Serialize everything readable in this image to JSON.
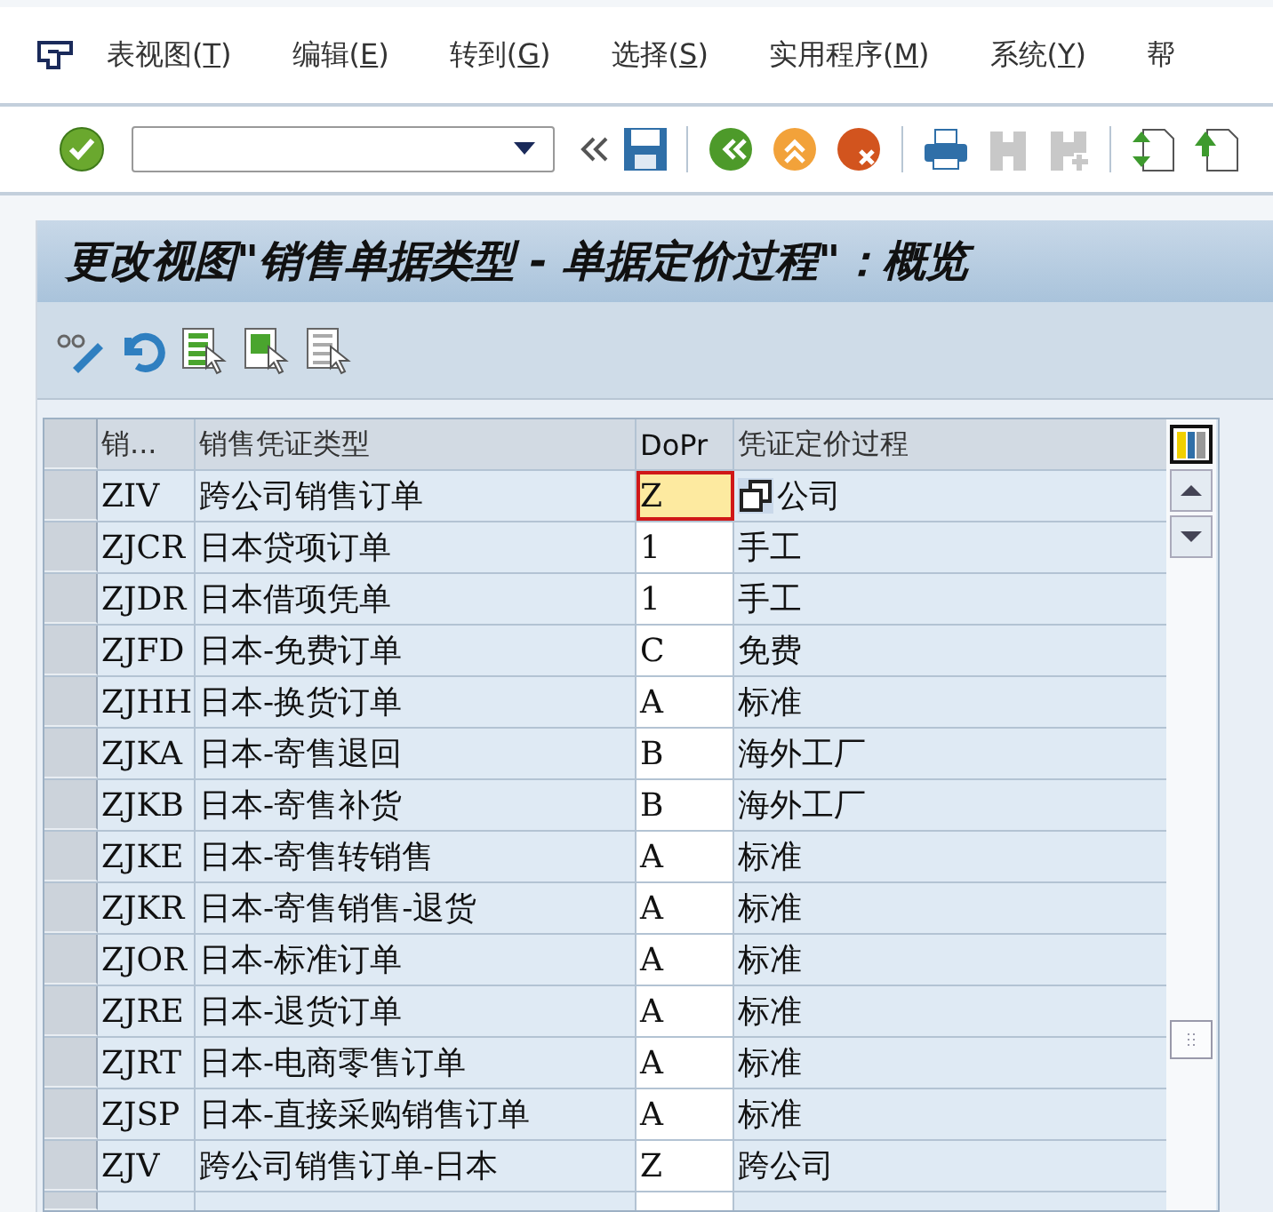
{
  "menu": [
    {
      "text": "表视图(",
      "key": "T",
      "tail": ")"
    },
    {
      "text": "编辑(",
      "key": "E",
      "tail": ")"
    },
    {
      "text": "转到(",
      "key": "G",
      "tail": ")"
    },
    {
      "text": "选择(",
      "key": "S",
      "tail": ")"
    },
    {
      "text": "实用程序(",
      "key": "M",
      "tail": ")"
    },
    {
      "text": "系统(",
      "key": "Y",
      "tail": ")"
    },
    {
      "text": "帮"
    }
  ],
  "title": "更改视图\"销售单据类型 - 单据定价过程\"：概览",
  "table": {
    "columns": [
      "销...",
      "销售凭证类型",
      "DoPr",
      "凭证定价过程"
    ],
    "rows": [
      {
        "code": "ZIV",
        "type": "跨公司销售订单",
        "dopr": "Z",
        "proc": "公司",
        "focused": true
      },
      {
        "code": "ZJCR",
        "type": "日本贷项订单",
        "dopr": "1",
        "proc": "手工",
        "focused": false
      },
      {
        "code": "ZJDR",
        "type": "日本借项凭单",
        "dopr": "1",
        "proc": "手工",
        "focused": false
      },
      {
        "code": "ZJFD",
        "type": "日本-免费订单",
        "dopr": "C",
        "proc": "免费",
        "focused": false
      },
      {
        "code": "ZJHH",
        "type": "日本-换货订单",
        "dopr": "A",
        "proc": "标准",
        "focused": false
      },
      {
        "code": "ZJKA",
        "type": "日本-寄售退回",
        "dopr": "B",
        "proc": "海外工厂",
        "focused": false
      },
      {
        "code": "ZJKB",
        "type": "日本-寄售补货",
        "dopr": "B",
        "proc": "海外工厂",
        "focused": false
      },
      {
        "code": "ZJKE",
        "type": "日本-寄售转销售",
        "dopr": "A",
        "proc": "标准",
        "focused": false
      },
      {
        "code": "ZJKR",
        "type": "日本-寄售销售-退货",
        "dopr": "A",
        "proc": "标准",
        "focused": false
      },
      {
        "code": "ZJOR",
        "type": "日本-标准订单",
        "dopr": "A",
        "proc": "标准",
        "focused": false
      },
      {
        "code": "ZJRE",
        "type": "日本-退货订单",
        "dopr": "A",
        "proc": "标准",
        "focused": false
      },
      {
        "code": "ZJRT",
        "type": "日本-电商零售订单",
        "dopr": "A",
        "proc": "标准",
        "focused": false
      },
      {
        "code": "ZJSP",
        "type": "日本-直接采购销售订单",
        "dopr": "A",
        "proc": "标准",
        "focused": false
      },
      {
        "code": "ZJV",
        "type": "跨公司销售订单-日本",
        "dopr": "Z",
        "proc": "跨公司",
        "focused": false
      }
    ]
  }
}
